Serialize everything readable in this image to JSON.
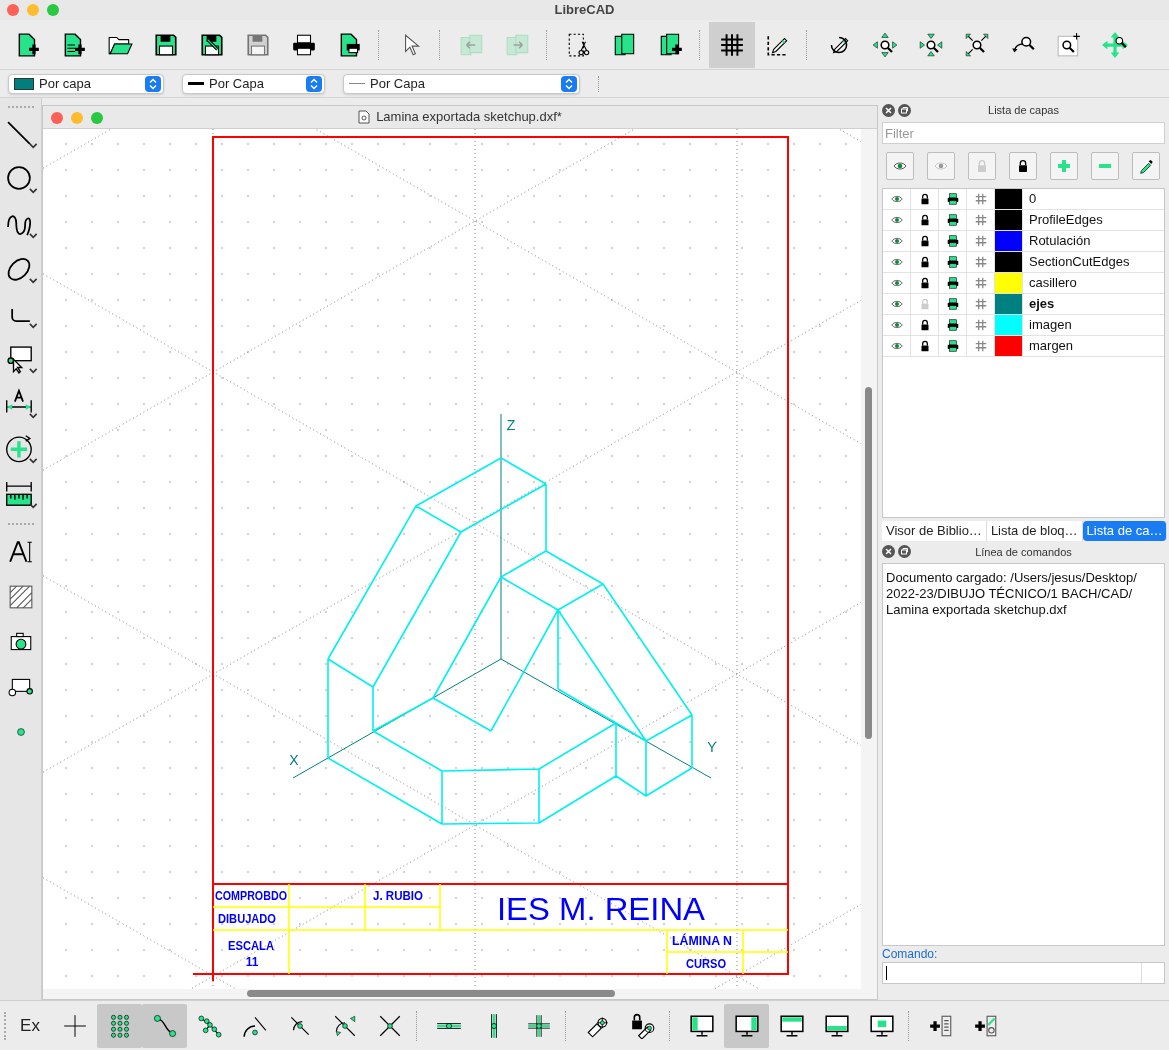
{
  "window": {
    "title": "LibreCAD"
  },
  "main_toolbar": [
    [
      {
        "kind": "new",
        "pressed": false,
        "disabled": false
      },
      {
        "kind": "new_template",
        "pressed": false,
        "disabled": false
      },
      {
        "kind": "open",
        "pressed": false,
        "disabled": false
      },
      {
        "kind": "save",
        "pressed": false,
        "disabled": false
      },
      {
        "kind": "save_as",
        "pressed": false,
        "disabled": false
      },
      {
        "kind": "save_all",
        "pressed": false,
        "disabled": true
      },
      {
        "kind": "print",
        "pressed": false,
        "disabled": false
      },
      {
        "kind": "print_preview",
        "pressed": false,
        "disabled": false
      }
    ],
    [
      {
        "kind": "pointer",
        "pressed": false,
        "disabled": false
      }
    ],
    [
      {
        "kind": "back",
        "pressed": false,
        "disabled": true
      },
      {
        "kind": "forward",
        "pressed": false,
        "disabled": true
      }
    ],
    [
      {
        "kind": "cut",
        "pressed": false,
        "disabled": false
      },
      {
        "kind": "copy",
        "pressed": false,
        "disabled": false
      },
      {
        "kind": "paste",
        "pressed": false,
        "disabled": false
      }
    ],
    [
      {
        "kind": "grid",
        "pressed": true,
        "disabled": false
      },
      {
        "kind": "draft",
        "pressed": false,
        "disabled": false
      }
    ],
    [
      {
        "kind": "redraw",
        "pressed": false,
        "disabled": false
      },
      {
        "kind": "zoom_in",
        "pressed": false,
        "disabled": false
      },
      {
        "kind": "zoom_out",
        "pressed": false,
        "disabled": false
      },
      {
        "kind": "zoom_auto",
        "pressed": false,
        "disabled": false
      },
      {
        "kind": "zoom_previous",
        "pressed": false,
        "disabled": false
      },
      {
        "kind": "zoom_window",
        "pressed": false,
        "disabled": false
      },
      {
        "kind": "zoom_pan",
        "pressed": false,
        "disabled": false
      }
    ]
  ],
  "pen_toolbar": [
    {
      "kind": "color",
      "value": "Por capa"
    },
    {
      "kind": "width",
      "value": "Por Capa"
    },
    {
      "kind": "linetype",
      "value": "Por Capa"
    }
  ],
  "tools": [
    [
      {
        "kind": "line",
        "has_submenu": true
      },
      {
        "kind": "circle",
        "has_submenu": true
      },
      {
        "kind": "curve",
        "has_submenu": true
      },
      {
        "kind": "ellipse",
        "has_submenu": true
      },
      {
        "kind": "polyline",
        "has_submenu": true
      },
      {
        "kind": "select",
        "has_submenu": true
      },
      {
        "kind": "dimension",
        "has_submenu": true
      },
      {
        "kind": "modify",
        "has_submenu": true
      },
      {
        "kind": "measure",
        "has_submenu": true
      }
    ],
    [
      {
        "kind": "text",
        "has_submenu": false
      },
      {
        "kind": "hatch",
        "has_submenu": false
      },
      {
        "kind": "image",
        "has_submenu": false
      },
      {
        "kind": "block",
        "has_submenu": false
      },
      {
        "kind": "point",
        "has_submenu": false
      }
    ]
  ],
  "document": {
    "title": "Lamina exportada sketchup.dxf*",
    "axis_labels": {
      "z": "Z",
      "x": "X",
      "y": "Y"
    },
    "title_block": {
      "checked_label": "COMPROBDO",
      "checked_by": "J. RUBIO",
      "drawn_label": "DIBUJADO",
      "school": "IES M. REINA",
      "scale_label": "ESCALA",
      "scale": "11",
      "sheet_label": "LÁMINA N",
      "course_label": "CURSO"
    }
  },
  "layers_panel": {
    "title": "Lista de capas",
    "filter": {
      "placeholder": "Filter"
    },
    "buttons": [
      {
        "kind": "show_all"
      },
      {
        "kind": "hide_all"
      },
      {
        "kind": "unlock_all"
      },
      {
        "kind": "lock_all"
      },
      {
        "kind": "add"
      },
      {
        "kind": "remove"
      },
      {
        "kind": "edit"
      }
    ],
    "layers": [
      {
        "name": "0",
        "color": "#000000",
        "visible": true,
        "locked": true,
        "printable": true,
        "construction": false,
        "active": false
      },
      {
        "name": "ProfileEdges",
        "color": "#000000",
        "visible": true,
        "locked": true,
        "printable": true,
        "construction": false,
        "active": false
      },
      {
        "name": "Rotulación",
        "color": "#0000ff",
        "visible": true,
        "locked": true,
        "printable": true,
        "construction": false,
        "active": false
      },
      {
        "name": "SectionCutEdges",
        "color": "#000000",
        "visible": true,
        "locked": true,
        "printable": true,
        "construction": false,
        "active": false
      },
      {
        "name": "casillero",
        "color": "#ffff00",
        "visible": true,
        "locked": true,
        "printable": true,
        "construction": false,
        "active": false
      },
      {
        "name": "ejes",
        "color": "#008080",
        "visible": true,
        "locked": false,
        "printable": true,
        "construction": false,
        "active": true
      },
      {
        "name": "imagen",
        "color": "#00ffff",
        "visible": true,
        "locked": true,
        "printable": true,
        "construction": false,
        "active": false
      },
      {
        "name": "margen",
        "color": "#ff0000",
        "visible": true,
        "locked": true,
        "printable": true,
        "construction": false,
        "active": false
      }
    ]
  },
  "dock_tabs": [
    {
      "label": "Visor de Biblio…",
      "selected": false
    },
    {
      "label": "Lista de bloq…",
      "selected": false
    },
    {
      "label": "Lista de ca…",
      "selected": true
    }
  ],
  "command_panel": {
    "title": "Línea de comandos",
    "output": "Documento cargado: /Users/jesus/Desktop/2022-23/DIBUJO TÉCNICO/1 BACH/CAD/Lamina exportada sketchup.dxf",
    "prompt_label": "Comando:"
  },
  "snap_toolbar": [
    [
      {
        "kind": "exclusive",
        "label": "Ex",
        "pressed": false
      },
      {
        "kind": "snap_free",
        "pressed": false
      },
      {
        "kind": "snap_grid",
        "pressed": true
      },
      {
        "kind": "snap_endpoint",
        "pressed": true
      },
      {
        "kind": "snap_entity",
        "pressed": false
      },
      {
        "kind": "snap_center",
        "pressed": false
      },
      {
        "kind": "snap_middle",
        "pressed": false
      },
      {
        "kind": "snap_distance",
        "pressed": false
      },
      {
        "kind": "snap_intersection",
        "pressed": false
      }
    ],
    [
      {
        "kind": "restrict_horizontal",
        "pressed": false
      },
      {
        "kind": "restrict_vertical",
        "pressed": false
      },
      {
        "kind": "restrict_orthogonal",
        "pressed": false
      }
    ],
    [
      {
        "kind": "relative_zero",
        "pressed": false
      },
      {
        "kind": "lock_relative_zero",
        "pressed": false
      }
    ],
    [
      {
        "kind": "view_left",
        "pressed": false
      },
      {
        "kind": "view_right",
        "pressed": true
      },
      {
        "kind": "view_top",
        "pressed": false
      },
      {
        "kind": "view_bottom",
        "pressed": false
      },
      {
        "kind": "view_center",
        "pressed": false
      }
    ],
    [
      {
        "kind": "block_add",
        "pressed": false
      },
      {
        "kind": "block_insert",
        "pressed": false
      }
    ]
  ]
}
